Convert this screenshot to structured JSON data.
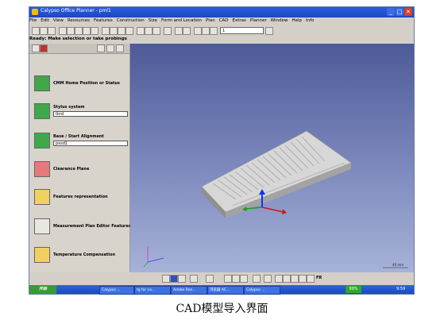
{
  "window": {
    "title": "Calypso Office Planner - pml1"
  },
  "menu": [
    "File",
    "Edit",
    "View",
    "Resources",
    "Features",
    "Construction",
    "Size",
    "Form and Location",
    "Plan",
    "CAD",
    "Extras",
    "Planner",
    "Window",
    "Help",
    "Info"
  ],
  "toolbar": {
    "dropdown_value": "1"
  },
  "status": {
    "text": "Ready: Make selection or take probings"
  },
  "panel": {
    "items": [
      {
        "label": "CMM Home Position or Status"
      },
      {
        "label": "Stylus system",
        "value": "tkrd"
      },
      {
        "label": "Base / Start Alignment",
        "value": "pxsd1"
      },
      {
        "label": "Clearance Plane"
      },
      {
        "label": "Features representation"
      },
      {
        "label": "Measurement Plan Editor Features"
      },
      {
        "label": "Temperature Compensation"
      }
    ]
  },
  "viewport": {
    "scale_label": "40 mm"
  },
  "bottombar": {
    "tail_label": "FR"
  },
  "taskbar": {
    "start": "开始",
    "tasks": [
      "Calypso ...",
      "tg for co...",
      "Adobe Rea...",
      "浏览器 AC...",
      "Calypso ..."
    ],
    "zoom": "99%",
    "clock": "9:59"
  },
  "caption": "CAD模型导入界面",
  "colors": {
    "titlebar": "#1c47c4",
    "viewport_top": "#4e5a98",
    "taskbar": "#1a4ab8"
  }
}
